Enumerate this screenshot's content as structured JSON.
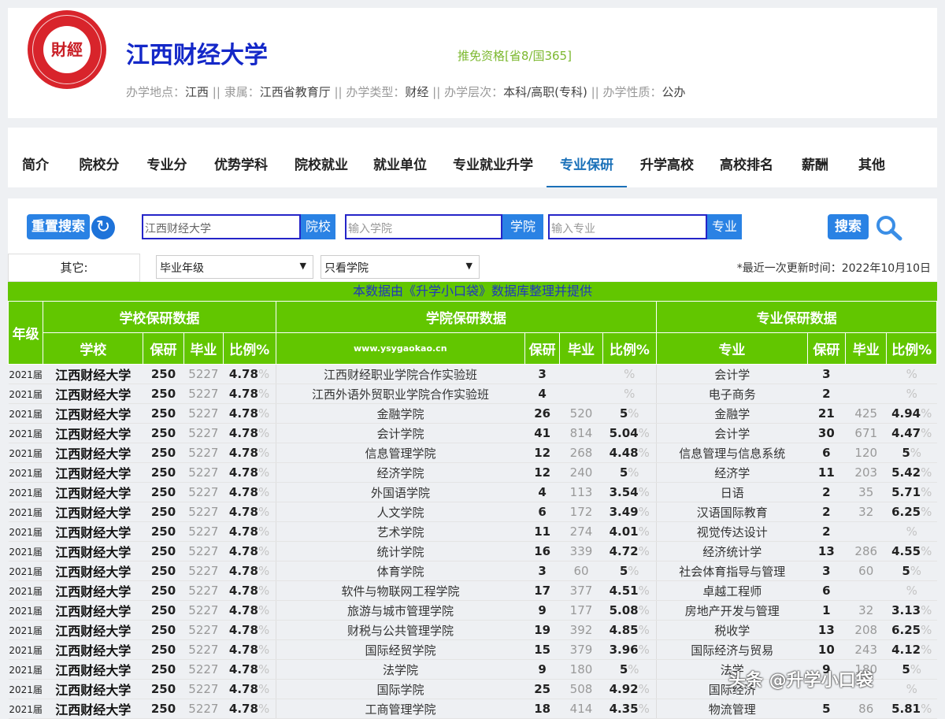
{
  "header": {
    "logo_text": "財經",
    "univ_name": "江西财经大学",
    "baoyan_tag": "推免资格[省8/国365]",
    "meta": [
      {
        "label": "办学地点：",
        "value": "江西"
      },
      {
        "label": "隶属：",
        "value": "江西省教育厅"
      },
      {
        "label": "办学类型：",
        "value": "财经"
      },
      {
        "label": "办学层次：",
        "value": "本科/高职(专科)"
      },
      {
        "label": "办学性质：",
        "value": "公办"
      }
    ],
    "meta_sep": " || "
  },
  "nav": {
    "tabs": [
      "简介",
      "院校分",
      "专业分",
      "优势学科",
      "院校就业",
      "就业单位",
      "专业就业升学",
      "专业保研",
      "升学高校",
      "高校排名",
      "薪酬",
      "其他"
    ],
    "active": "专业保研"
  },
  "search": {
    "reset_label": "重置搜索",
    "school_value": "江西财经大学",
    "school_btn": "院校",
    "college_placeholder": "输入学院",
    "college_btn": "学院",
    "major_placeholder": "输入专业",
    "major_btn": "专业",
    "search_label": "搜索",
    "other_label": "其它:",
    "grade_select": "毕业年级",
    "college_select": "只看学院",
    "update_time": "*最近一次更新时间：2022年10月10日"
  },
  "notice": "本数据由《升学小口袋》数据库整理并提供",
  "table": {
    "group_headers": {
      "year": "年级",
      "school_group": "学校保研数据",
      "college_group": "学院保研数据",
      "major_group": "专业保研数据"
    },
    "sub_headers": {
      "school": "学校",
      "baoyan": "保研",
      "grads": "毕业",
      "ratio": "比例%",
      "website": "www.ysygaokao.cn",
      "major": "专业"
    },
    "year": "2021届",
    "school": {
      "name": "江西财经大学",
      "baoyan": "250",
      "grads": "5227",
      "ratio": "4.78"
    },
    "pct_sign": "%",
    "rows": [
      {
        "college": "江西财经职业学院合作实验班",
        "c_by": "3",
        "c_grad": "",
        "c_ratio": "",
        "major": "会计学",
        "m_by": "3",
        "m_grad": "",
        "m_ratio": ""
      },
      {
        "college": "江西外语外贸职业学院合作实验班",
        "c_by": "4",
        "c_grad": "",
        "c_ratio": "",
        "major": "电子商务",
        "m_by": "2",
        "m_grad": "",
        "m_ratio": ""
      },
      {
        "college": "金融学院",
        "c_by": "26",
        "c_grad": "520",
        "c_ratio": "5",
        "major": "金融学",
        "m_by": "21",
        "m_grad": "425",
        "m_ratio": "4.94"
      },
      {
        "college": "会计学院",
        "c_by": "41",
        "c_grad": "814",
        "c_ratio": "5.04",
        "major": "会计学",
        "m_by": "30",
        "m_grad": "671",
        "m_ratio": "4.47"
      },
      {
        "college": "信息管理学院",
        "c_by": "12",
        "c_grad": "268",
        "c_ratio": "4.48",
        "major": "信息管理与信息系统",
        "m_by": "6",
        "m_grad": "120",
        "m_ratio": "5"
      },
      {
        "college": "经济学院",
        "c_by": "12",
        "c_grad": "240",
        "c_ratio": "5",
        "major": "经济学",
        "m_by": "11",
        "m_grad": "203",
        "m_ratio": "5.42"
      },
      {
        "college": "外国语学院",
        "c_by": "4",
        "c_grad": "113",
        "c_ratio": "3.54",
        "major": "日语",
        "m_by": "2",
        "m_grad": "35",
        "m_ratio": "5.71"
      },
      {
        "college": "人文学院",
        "c_by": "6",
        "c_grad": "172",
        "c_ratio": "3.49",
        "major": "汉语国际教育",
        "m_by": "2",
        "m_grad": "32",
        "m_ratio": "6.25"
      },
      {
        "college": "艺术学院",
        "c_by": "11",
        "c_grad": "274",
        "c_ratio": "4.01",
        "major": "视觉传达设计",
        "m_by": "2",
        "m_grad": "",
        "m_ratio": ""
      },
      {
        "college": "统计学院",
        "c_by": "16",
        "c_grad": "339",
        "c_ratio": "4.72",
        "major": "经济统计学",
        "m_by": "13",
        "m_grad": "286",
        "m_ratio": "4.55"
      },
      {
        "college": "体育学院",
        "c_by": "3",
        "c_grad": "60",
        "c_ratio": "5",
        "major": "社会体育指导与管理",
        "m_by": "3",
        "m_grad": "60",
        "m_ratio": "5"
      },
      {
        "college": "软件与物联网工程学院",
        "c_by": "17",
        "c_grad": "377",
        "c_ratio": "4.51",
        "major": "卓越工程师",
        "m_by": "6",
        "m_grad": "",
        "m_ratio": ""
      },
      {
        "college": "旅游与城市管理学院",
        "c_by": "9",
        "c_grad": "177",
        "c_ratio": "5.08",
        "major": "房地产开发与管理",
        "m_by": "1",
        "m_grad": "32",
        "m_ratio": "3.13"
      },
      {
        "college": "财税与公共管理学院",
        "c_by": "19",
        "c_grad": "392",
        "c_ratio": "4.85",
        "major": "税收学",
        "m_by": "13",
        "m_grad": "208",
        "m_ratio": "6.25"
      },
      {
        "college": "国际经贸学院",
        "c_by": "15",
        "c_grad": "379",
        "c_ratio": "3.96",
        "major": "国际经济与贸易",
        "m_by": "10",
        "m_grad": "243",
        "m_ratio": "4.12"
      },
      {
        "college": "法学院",
        "c_by": "9",
        "c_grad": "180",
        "c_ratio": "5",
        "major": "法学",
        "m_by": "9",
        "m_grad": "180",
        "m_ratio": "5"
      },
      {
        "college": "国际学院",
        "c_by": "25",
        "c_grad": "508",
        "c_ratio": "4.92",
        "major": "国际经济",
        "m_by": "",
        "m_grad": "",
        "m_ratio": ""
      },
      {
        "college": "工商管理学院",
        "c_by": "18",
        "c_grad": "414",
        "c_ratio": "4.35",
        "major": "物流管理",
        "m_by": "5",
        "m_grad": "86",
        "m_ratio": "5.81"
      }
    ]
  },
  "watermark": "头条 @升学小口袋"
}
